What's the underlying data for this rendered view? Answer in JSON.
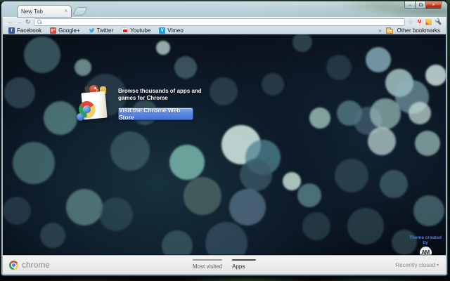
{
  "browser": {
    "tab_title": "New Tab",
    "omnibox_value": "",
    "overflow_chevron": "»",
    "other_bookmarks_label": "Other bookmarks"
  },
  "bookmarks": [
    {
      "label": "Facebook",
      "icon": "facebook",
      "glyph": "f"
    },
    {
      "label": "Google+",
      "icon": "googleplus",
      "glyph": "g+"
    },
    {
      "label": "Twitter",
      "icon": "twitter",
      "glyph": ""
    },
    {
      "label": "Youtube",
      "icon": "youtube",
      "glyph": ""
    },
    {
      "label": "Vimeo",
      "icon": "vimeo",
      "glyph": "V"
    }
  ],
  "promo": {
    "line1": "Browse thousands of apps and",
    "line2": "games for Chrome",
    "button_label": "Visit the Chrome Web Store"
  },
  "theme_credit": {
    "label": "Theme created by",
    "monogram": "AM"
  },
  "footer": {
    "brand": "chrome",
    "tabs": [
      {
        "label": "Most visited",
        "active": false
      },
      {
        "label": "Apps",
        "active": true
      }
    ],
    "recently_closed_label": "Recently closed",
    "dropdown_arrow": "▾"
  },
  "colors": {
    "button_blue": "#5c88e2",
    "credit_blue": "#4d7fd8",
    "bokeh_base": "#0a1520"
  }
}
